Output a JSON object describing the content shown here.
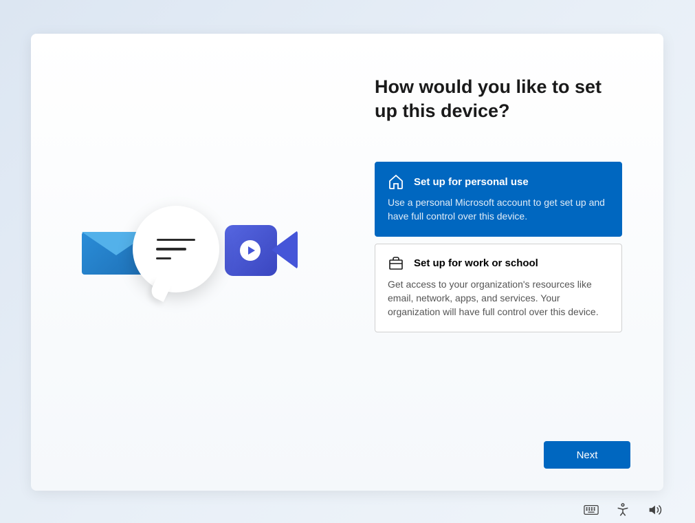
{
  "heading": "How would you like to set up this device?",
  "options": [
    {
      "title": "Set up for personal use",
      "description": "Use a personal Microsoft account to get set up and have full control over this device.",
      "selected": true,
      "icon": "home-icon"
    },
    {
      "title": "Set up for work or school",
      "description": "Get access to your organization's resources like email, network, apps, and services. Your organization will have full control over this device.",
      "selected": false,
      "icon": "briefcase-icon"
    }
  ],
  "buttons": {
    "next": "Next"
  },
  "taskbar": {
    "keyboard": "keyboard-icon",
    "accessibility": "accessibility-icon",
    "volume": "volume-icon"
  }
}
